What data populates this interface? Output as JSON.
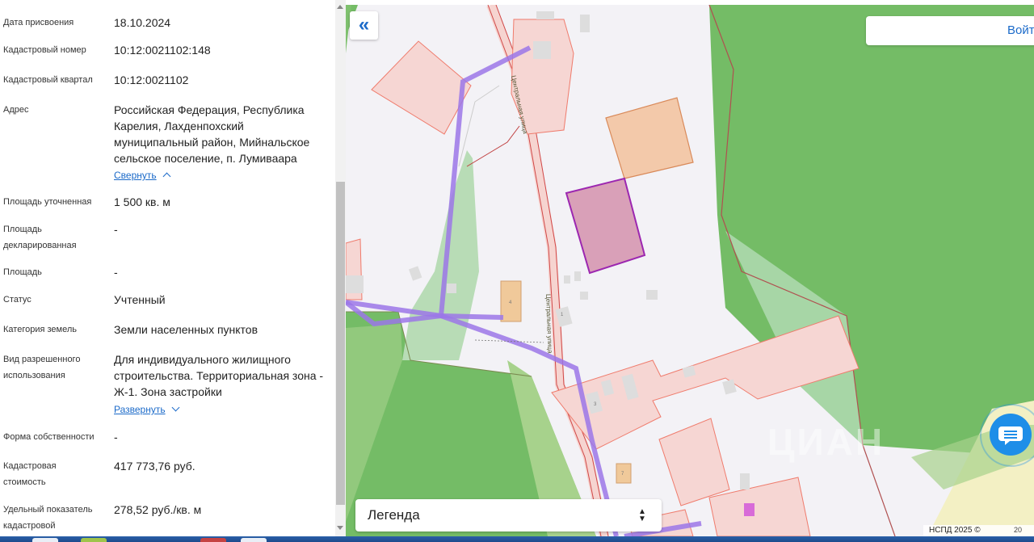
{
  "info_panel": {
    "rows": [
      {
        "label": "Дата присвоения",
        "value": "18.10.2024"
      },
      {
        "label": "Кадастровый номер",
        "value": "10:12:0021102:148"
      },
      {
        "label": "Кадастровый квартал",
        "value": "10:12:0021102"
      },
      {
        "label": "Адрес",
        "value": "Российская Федерация, Республика Карелия, Лахденпохский муниципальный район, Мийнальское сельское поселение, п. Лумиваара",
        "link": "Свернуть"
      },
      {
        "label": "Площадь уточненная",
        "value": "1 500 кв. м"
      },
      {
        "label": "Площадь декларированная",
        "value": "-"
      },
      {
        "label": "Площадь",
        "value": "-"
      },
      {
        "label": "Статус",
        "value": "Учтенный"
      },
      {
        "label": "Категория земель",
        "value": "Земли населенных пунктов"
      },
      {
        "label": "Вид разрешенного использования",
        "value": "Для индивидуального жилищного строительства. Территориальная зона - Ж-1. Зона застройки",
        "link": "Развернуть"
      },
      {
        "label": "Форма собственности",
        "value": "-"
      },
      {
        "label": "Кадастровая стоимость",
        "value": "417 773,76 руб."
      },
      {
        "label": "Удельный показатель кадастровой",
        "value": "278,52 руб./кв. м"
      }
    ]
  },
  "map": {
    "collapse_button": "«",
    "login_button": "Войти",
    "legend": {
      "title": "Легенда"
    },
    "street_label": "Центральная улица",
    "watermark": "ЦИАН",
    "attribution": "НСПД 2025 ©",
    "scale_label": "20",
    "parcel_numbers": [
      "4",
      "1",
      "3",
      "7"
    ],
    "colors": {
      "selected_parcel": "#d9a0b8",
      "selected_border": "#9c27b0",
      "route": "#9b77e8",
      "forest": "#74bc66",
      "light_green": "#a7d28c",
      "parcel_fill": "#f6d6d3",
      "parcel_border": "#ef7b6c"
    }
  },
  "icons": {
    "chat": "chat-bubble-icon"
  }
}
